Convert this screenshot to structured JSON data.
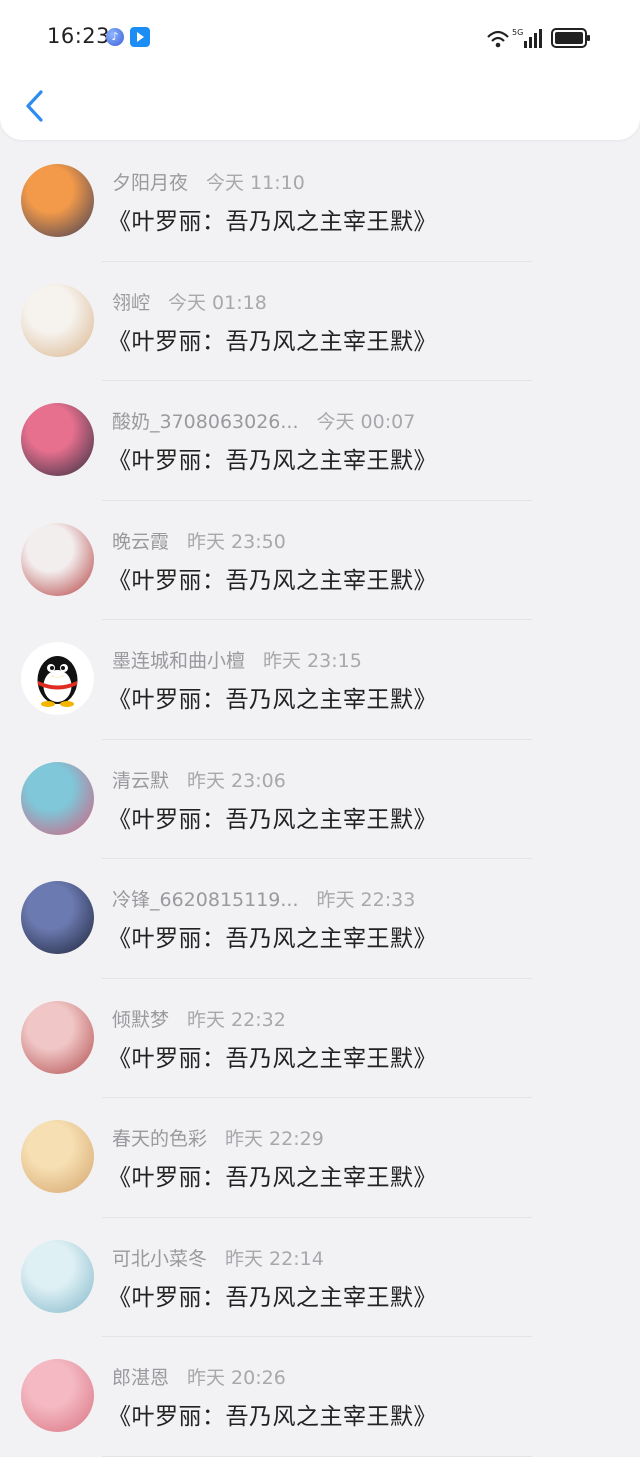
{
  "status_bar": {
    "time": "16:23",
    "network_label": "5G"
  },
  "messages": [
    {
      "name": "夕阳月夜",
      "time": "今天 11:10",
      "text": "《叶罗丽：吾乃风之主宰王默》",
      "avatar_colors": [
        "#f39a4a",
        "#3b3b55"
      ]
    },
    {
      "name": "翎崆",
      "time": "今天 01:18",
      "text": "《叶罗丽：吾乃风之主宰王默》",
      "avatar_colors": [
        "#f6f3ee",
        "#d9b38a"
      ]
    },
    {
      "name": "酸奶_3708063026...",
      "time": "今天 00:07",
      "text": "《叶罗丽：吾乃风之主宰王默》",
      "avatar_colors": [
        "#e7708f",
        "#2c2c3c"
      ]
    },
    {
      "name": "晚云霞",
      "time": "昨天 23:50",
      "text": "《叶罗丽：吾乃风之主宰王默》",
      "avatar_colors": [
        "#f3eeee",
        "#b33a3a"
      ]
    },
    {
      "name": "墨连城和曲小檀",
      "time": "昨天 23:15",
      "text": "《叶罗丽：吾乃风之主宰王默》",
      "avatar_colors": [
        "#ffffff",
        "#111111"
      ]
    },
    {
      "name": "清云默",
      "time": "昨天 23:06",
      "text": "《叶罗丽：吾乃风之主宰王默》",
      "avatar_colors": [
        "#7fc7d9",
        "#d65a7a"
      ]
    },
    {
      "name": "冷锋_6620815119...",
      "time": "昨天 22:33",
      "text": "《叶罗丽：吾乃风之主宰王默》",
      "avatar_colors": [
        "#6b7ab0",
        "#1d2338"
      ]
    },
    {
      "name": "倾默梦",
      "time": "昨天 22:32",
      "text": "《叶罗丽：吾乃风之主宰王默》",
      "avatar_colors": [
        "#f1c6c6",
        "#b04a4a"
      ]
    },
    {
      "name": "春天的色彩",
      "time": "昨天 22:29",
      "text": "《叶罗丽：吾乃风之主宰王默》",
      "avatar_colors": [
        "#f6dfb2",
        "#d4a36b"
      ]
    },
    {
      "name": "可北小菜冬",
      "time": "昨天 22:14",
      "text": "《叶罗丽：吾乃风之主宰王默》",
      "avatar_colors": [
        "#dff0f5",
        "#7fb6c8"
      ]
    },
    {
      "name": "郎湛恩",
      "time": "昨天 20:26",
      "text": "《叶罗丽：吾乃风之主宰王默》",
      "avatar_colors": [
        "#f4b9c3",
        "#d8717f"
      ]
    }
  ]
}
